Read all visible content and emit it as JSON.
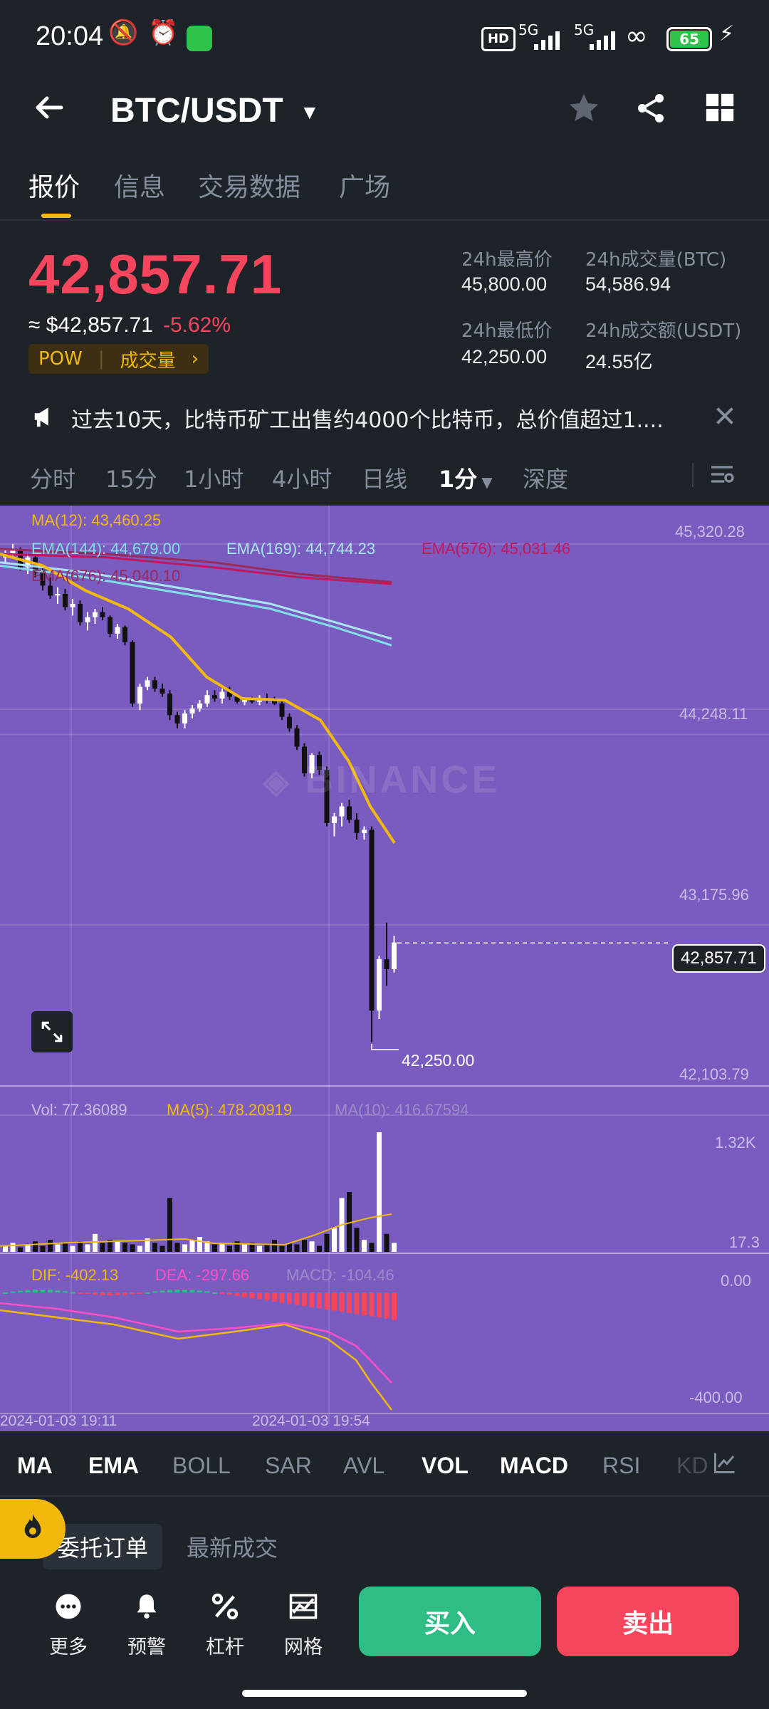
{
  "status_bar": {
    "time": "20:04",
    "network": "5G",
    "battery": "65"
  },
  "header": {
    "pair": "BTC/USDT"
  },
  "tabs": [
    {
      "label": "报价",
      "active": true
    },
    {
      "label": "信息",
      "active": false
    },
    {
      "label": "交易数据",
      "active": false
    },
    {
      "label": "广场",
      "active": false
    }
  ],
  "price": {
    "last": "42,857.71",
    "usd": "≈ $42,857.71",
    "change": "-5.62%",
    "tag": "POW",
    "tag_link": "成交量"
  },
  "stats": {
    "high_label": "24h最高价",
    "high_value": "45,800.00",
    "low_label": "24h最低价",
    "low_value": "42,250.00",
    "vol_btc_label": "24h成交量(BTC)",
    "vol_btc_value": "54,586.94",
    "vol_usdt_label": "24h成交额(USDT)",
    "vol_usdt_value": "24.55亿"
  },
  "news": {
    "text": "过去10天，比特币矿工出售约4000个比特币，总价值超过1...."
  },
  "intervals": [
    {
      "label": "分时",
      "active": false
    },
    {
      "label": "15分",
      "active": false
    },
    {
      "label": "1小时",
      "active": false
    },
    {
      "label": "4小时",
      "active": false
    },
    {
      "label": "日线",
      "active": false
    },
    {
      "label": "1分",
      "active": true
    },
    {
      "label": "深度",
      "active": false
    }
  ],
  "chart_data": {
    "type": "candlestick",
    "ma_labels": {
      "ma12": "MA(12): 43,460.25",
      "ema144": "EMA(144): 44,679.00",
      "ema169": "EMA(169): 44,744.23",
      "ema576": "EMA(576): 45,031.46",
      "ema676": "EMA(676): 45,040.10"
    },
    "y_ticks": [
      "45,320.28",
      "44,248.11",
      "43,175.96",
      "42,103.79"
    ],
    "y_min": 42103.79,
    "y_max": 45320.28,
    "last_price_label": "42,857.71",
    "last_price": 42857.71,
    "low_marker": "42,250.00",
    "low_marker_value": 42250.0,
    "watermark": "BINANCE",
    "candles": [
      [
        45180,
        45230,
        45140,
        45200
      ],
      [
        45200,
        45260,
        45170,
        45220
      ],
      [
        45220,
        45240,
        45100,
        45120
      ],
      [
        45120,
        45200,
        45080,
        45180
      ],
      [
        45180,
        45200,
        45060,
        45090
      ],
      [
        45090,
        45130,
        44980,
        45010
      ],
      [
        45010,
        45060,
        44930,
        44950
      ],
      [
        44950,
        45000,
        44900,
        44960
      ],
      [
        44960,
        44990,
        44860,
        44880
      ],
      [
        44880,
        44930,
        44830,
        44900
      ],
      [
        44900,
        44920,
        44770,
        44790
      ],
      [
        44790,
        44850,
        44740,
        44820
      ],
      [
        44820,
        44870,
        44780,
        44850
      ],
      [
        44850,
        44880,
        44800,
        44820
      ],
      [
        44820,
        44830,
        44700,
        44720
      ],
      [
        44720,
        44780,
        44690,
        44760
      ],
      [
        44760,
        44770,
        44650,
        44670
      ],
      [
        44670,
        44680,
        44280,
        44300
      ],
      [
        44300,
        44420,
        44260,
        44400
      ],
      [
        44400,
        44460,
        44380,
        44440
      ],
      [
        44440,
        44460,
        44370,
        44390
      ],
      [
        44390,
        44420,
        44340,
        44360
      ],
      [
        44360,
        44380,
        44200,
        44230
      ],
      [
        44230,
        44250,
        44150,
        44180
      ],
      [
        44180,
        44260,
        44150,
        44240
      ],
      [
        44240,
        44290,
        44210,
        44270
      ],
      [
        44270,
        44320,
        44250,
        44300
      ],
      [
        44300,
        44380,
        44280,
        44350
      ],
      [
        44350,
        44380,
        44310,
        44330
      ],
      [
        44330,
        44390,
        44300,
        44370
      ],
      [
        44370,
        44400,
        44320,
        44340
      ],
      [
        44340,
        44350,
        44300,
        44310
      ],
      [
        44310,
        44330,
        44290,
        44320
      ],
      [
        44320,
        44340,
        44300,
        44310
      ],
      [
        44310,
        44350,
        44290,
        44330
      ],
      [
        44330,
        44360,
        44300,
        44320
      ],
      [
        44320,
        44340,
        44290,
        44300
      ],
      [
        44300,
        44320,
        44200,
        44220
      ],
      [
        44220,
        44240,
        44130,
        44150
      ],
      [
        44150,
        44170,
        44020,
        44040
      ],
      [
        44040,
        44060,
        43860,
        43880
      ],
      [
        43880,
        44000,
        43850,
        43990
      ],
      [
        43990,
        44010,
        43870,
        43900
      ],
      [
        43900,
        43920,
        43560,
        43580
      ],
      [
        43580,
        43640,
        43500,
        43620
      ],
      [
        43620,
        43700,
        43560,
        43680
      ],
      [
        43680,
        43720,
        43580,
        43600
      ],
      [
        43600,
        43640,
        43480,
        43520
      ],
      [
        43520,
        43560,
        43480,
        43540
      ],
      [
        43540,
        43560,
        42260,
        42450
      ],
      [
        42450,
        42780,
        42400,
        42760
      ],
      [
        42760,
        42980,
        42600,
        42700
      ],
      [
        42700,
        42900,
        42680,
        42860
      ]
    ]
  },
  "volume_pane": {
    "vol_label": "Vol: 77.36089",
    "ma5_label": "MA(5): 478.20919",
    "ma10_label": "MA(10): 416.67594",
    "y_top": "1.32K",
    "y_bottom": "17.3",
    "values": [
      20,
      30,
      15,
      25,
      35,
      20,
      40,
      25,
      30,
      20,
      35,
      25,
      60,
      30,
      40,
      35,
      30,
      25,
      20,
      45,
      30,
      20,
      180,
      30,
      25,
      40,
      50,
      35,
      25,
      30,
      20,
      35,
      25,
      30,
      20,
      25,
      40,
      20,
      30,
      25,
      40,
      35,
      20,
      60,
      80,
      180,
      200,
      80,
      40,
      30,
      400,
      60,
      30
    ]
  },
  "macd_pane": {
    "dif_label": "DIF: -402.13",
    "dea_label": "DEA: -297.66",
    "macd_label": "MACD: -104.46",
    "y_top": "0.00",
    "y_bottom": "-400.00"
  },
  "x_ticks": [
    "2024-01-03 19:11",
    "2024-01-03 19:54"
  ],
  "indicators": [
    {
      "label": "MA",
      "on": true
    },
    {
      "label": "EMA",
      "on": true
    },
    {
      "label": "BOLL",
      "on": false
    },
    {
      "label": "SAR",
      "on": false
    },
    {
      "label": "AVL",
      "on": false
    },
    {
      "label": "VOL",
      "on": true
    },
    {
      "label": "MACD",
      "on": true
    },
    {
      "label": "RSI",
      "on": false
    },
    {
      "label": "KD",
      "on": false
    }
  ],
  "order_tabs": {
    "active": "委托订单",
    "other": "最新成交"
  },
  "bottom_bar": {
    "more": "更多",
    "alert": "预警",
    "leverage": "杠杆",
    "grid": "网格",
    "buy": "买入",
    "sell": "卖出"
  },
  "colors": {
    "up": "#0ecb81",
    "down": "#f6465d",
    "accent": "#f0b90b",
    "chart_bg": "#7a5bbf"
  }
}
